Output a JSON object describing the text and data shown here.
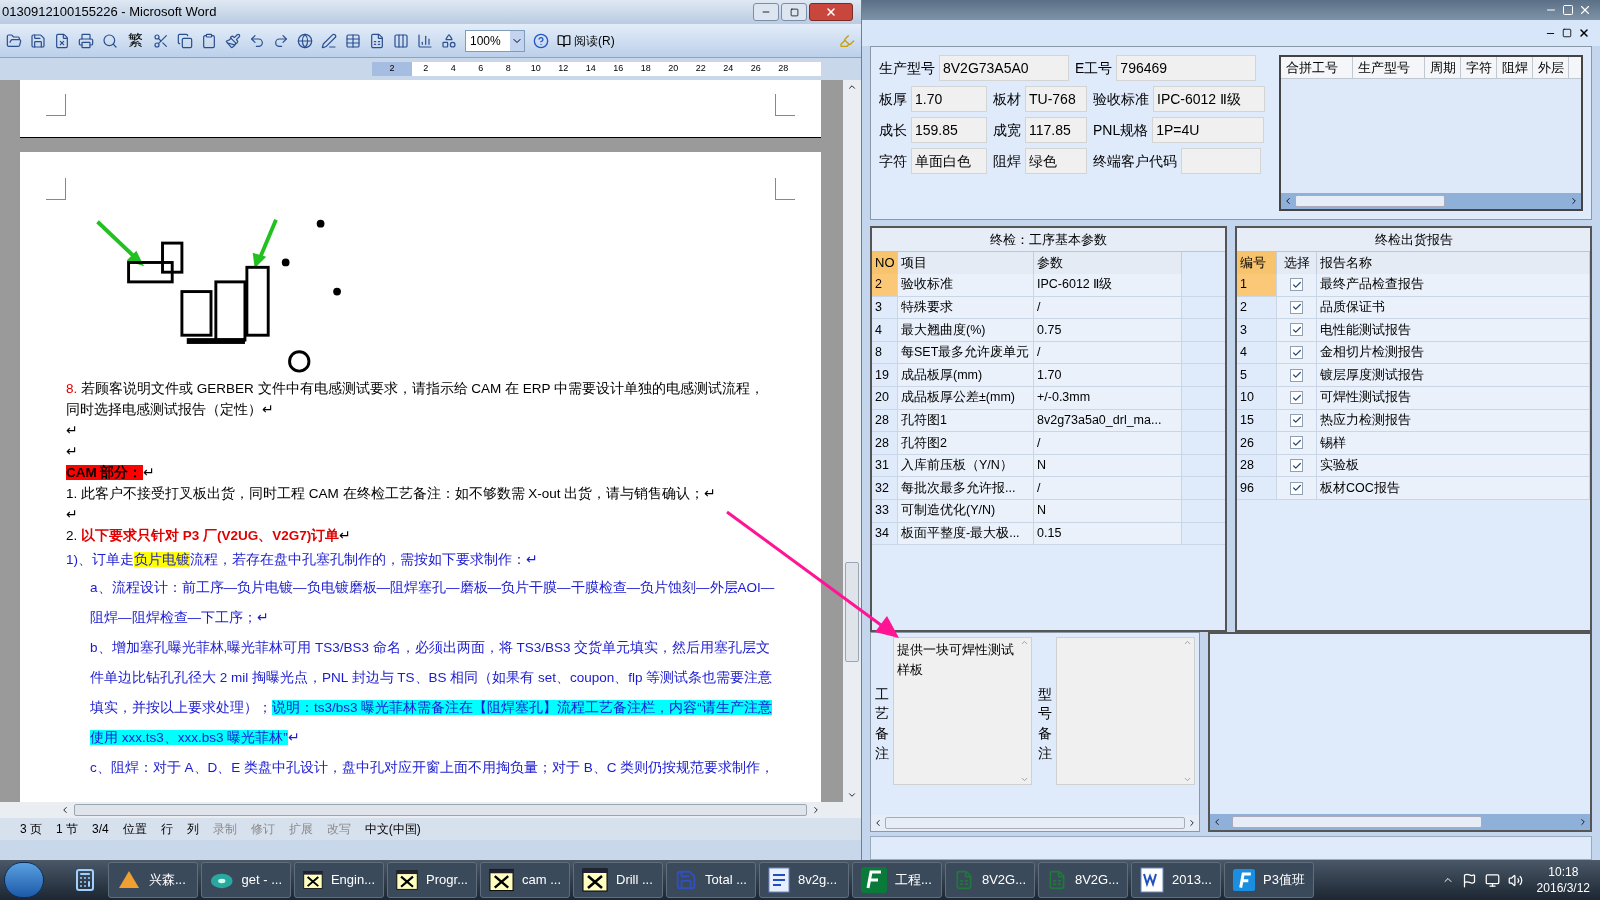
{
  "word": {
    "title": "0130912100155226 - Microsoft Word",
    "toolbar": {
      "traditional": "繁",
      "zoom": "100%",
      "read": "阅读(R)"
    },
    "ruler_ticks": [
      "2",
      "2",
      "4",
      "6",
      "8",
      "10",
      "12",
      "14",
      "16",
      "18",
      "20",
      "22",
      "24",
      "26",
      "28"
    ],
    "paragraphs": [
      {
        "kind": "plain",
        "segments": [
          {
            "kind": "number",
            "text": "8."
          },
          {
            "kind": "text",
            "text": " 若顾客说明文件或 GERBER 文件中有电感测试要求，请指示给 CAM 在 ERP 中需要设计单独的电感测试流程，同时选择电感测试报告（定性）↵"
          }
        ]
      },
      {
        "kind": "plain",
        "segments": [
          {
            "kind": "text",
            "text": "↵"
          }
        ]
      },
      {
        "kind": "plain",
        "segments": [
          {
            "kind": "text",
            "text": "↵"
          }
        ]
      },
      {
        "kind": "plain",
        "segments": [
          {
            "kind": "label",
            "text": "CAM 部分："
          },
          {
            "kind": "text",
            "text": "↵"
          }
        ]
      },
      {
        "kind": "plain",
        "segments": [
          {
            "kind": "text",
            "text": "1.   此客户不接受打叉板出货，同时工程 CAM 在终检工艺备注：如不够数需 X-out 出货，请与销售确认；↵"
          }
        ]
      },
      {
        "kind": "plain",
        "segments": [
          {
            "kind": "text",
            "text": "↵"
          }
        ]
      },
      {
        "kind": "plain",
        "segments": [
          {
            "kind": "text",
            "text": "2.   "
          },
          {
            "kind": "emphasis",
            "text": "以下要求只针对 P3 厂(V2UG、V2G7)订单"
          },
          {
            "kind": "text",
            "text": "↵"
          }
        ]
      },
      {
        "kind": "blue",
        "segments": [
          {
            "kind": "text",
            "text": "1)、订单走"
          },
          {
            "kind": "highlight",
            "text": "负片电镀"
          },
          {
            "kind": "text",
            "text": "流程，若存在盘中孔塞孔制作的，需按如下要求制作：↵"
          }
        ]
      },
      {
        "kind": "blue_indent",
        "segments": [
          {
            "kind": "text",
            "text": "a、流程设计：前工序—负片电镀—负电镀磨板—阻焊塞孔—磨板—负片干膜—干膜检查—负片蚀刻—外层AOI—阻焊—阻焊检查—下工序；↵"
          }
        ]
      },
      {
        "kind": "blue_indent",
        "segments": [
          {
            "kind": "text",
            "text": "b、增加塞孔曝光菲林,曝光菲林可用 TS3/BS3 命名，必须出两面，将 TS3/BS3 交货单元填实，然后用塞孔层文件单边比钻孔孔径大 2 mil 掏曝光点，PNL 封边与 TS、BS 相同（如果有 set、coupon、flp 等测试条也需要注意填实，并按以上要求处理）；"
          },
          {
            "kind": "note",
            "text": "说明：ts3/bs3 曝光菲林需备注在【阻焊塞孔】流程工艺备注栏，内容“请生产注意使用 xxx.ts3、xxx.bs3 曝光菲林”"
          },
          {
            "kind": "text",
            "text": "↵"
          }
        ]
      },
      {
        "kind": "blue_indent",
        "segments": [
          {
            "kind": "text",
            "text": "c、阻焊：对于 A、D、E 类盘中孔设计，盘中孔对应开窗上面不用掏负量；对于 B、C 类则仍按规范要求制作，"
          }
        ]
      }
    ],
    "status": [
      {
        "text": "3 页"
      },
      {
        "text": "1 节"
      },
      {
        "text": "3/4"
      },
      {
        "text": "位置"
      },
      {
        "text": "行"
      },
      {
        "text": "列"
      },
      {
        "text": "录制",
        "disabled": true
      },
      {
        "text": "修订",
        "disabled": true
      },
      {
        "text": "扩展",
        "disabled": true
      },
      {
        "text": "改写",
        "disabled": true
      },
      {
        "text": "中文(中国)"
      }
    ]
  },
  "app": {
    "fields": [
      [
        {
          "label": "生产型号",
          "value": "8V2G73A5A0"
        },
        {
          "label": "E工号",
          "value": "796469"
        }
      ],
      [
        {
          "label": "板厚",
          "value": "1.70"
        },
        {
          "label": "板材",
          "value": "TU-768"
        },
        {
          "label": "验收标准",
          "value": "IPC-6012 Ⅱ级"
        }
      ],
      [
        {
          "label": "成长",
          "value": "159.85"
        },
        {
          "label": "成宽",
          "value": "117.85"
        },
        {
          "label": "PNL规格",
          "value": "1P=4U"
        }
      ],
      [
        {
          "label": "字符",
          "value": "单面白色"
        },
        {
          "label": "阻焊",
          "value": "绿色"
        },
        {
          "label": "终端客户代码"
        }
      ]
    ],
    "merge_table": {
      "columns": [
        "合拼工号",
        "生产型号",
        "周期",
        "字符",
        "阻焊",
        "外层"
      ]
    },
    "params": {
      "title": "终检：工序基本参数",
      "columns": [
        "NO",
        "项目",
        "参数"
      ],
      "rows": [
        {
          "no": "2",
          "item": "验收标准",
          "value": "IPC-6012 Ⅱ级",
          "selected": true
        },
        {
          "no": "3",
          "item": "特殊要求",
          "value": "/",
          "selected": false
        },
        {
          "no": "4",
          "item": "最大翘曲度(%)",
          "value": "0.75",
          "selected": false
        },
        {
          "no": "8",
          "item": "每SET最多允许废单元",
          "value": "/",
          "selected": false
        },
        {
          "no": "19",
          "item": "成品板厚(mm)",
          "value": "1.70",
          "selected": false
        },
        {
          "no": "20",
          "item": "成品板厚公差±(mm)",
          "value": "+/-0.3mm",
          "selected": false
        },
        {
          "no": "28",
          "item": "孔符图1",
          "value": "8v2g73a5a0_drl_ma...",
          "selected": false
        },
        {
          "no": "28",
          "item": "孔符图2",
          "value": "/",
          "selected": false
        },
        {
          "no": "31",
          "item": "入库前压板（Y/N）",
          "value": "N",
          "selected": false
        },
        {
          "no": "32",
          "item": "每批次最多允许报...",
          "value": "/",
          "selected": false
        },
        {
          "no": "33",
          "item": "可制造优化(Y/N)",
          "value": "N",
          "selected": false
        },
        {
          "no": "34",
          "item": "板面平整度-最大极...",
          "value": "0.15",
          "selected": false
        }
      ]
    },
    "reports": {
      "title": "终检出货报告",
      "columns": [
        "编号",
        "选择",
        "报告名称"
      ],
      "rows": [
        {
          "no": "1",
          "checked": true,
          "name": "最终产品检查报告",
          "selected": true
        },
        {
          "no": "2",
          "checked": true,
          "name": "品质保证书",
          "selected": false
        },
        {
          "no": "3",
          "checked": true,
          "name": "电性能测试报告",
          "selected": false
        },
        {
          "no": "4",
          "checked": true,
          "name": "金相切片检测报告",
          "selected": false
        },
        {
          "no": "5",
          "checked": true,
          "name": "镀层厚度测试报告",
          "selected": false
        },
        {
          "no": "10",
          "checked": true,
          "name": "可焊性测试报告",
          "selected": false
        },
        {
          "no": "15",
          "checked": true,
          "name": "热应力检测报告",
          "selected": false
        },
        {
          "no": "26",
          "checked": true,
          "name": "锡样",
          "selected": false
        },
        {
          "no": "28",
          "checked": true,
          "name": "实验板",
          "selected": false
        },
        {
          "no": "96",
          "checked": true,
          "name": "板材COC报告",
          "selected": false
        }
      ]
    },
    "remarks": [
      {
        "label": "工艺备注",
        "text": "提供一块可焊性测试样板"
      },
      {
        "label": "型号备注"
      }
    ]
  },
  "taskbar": {
    "items": [
      {
        "kind": "calculator"
      },
      {
        "kind": "shell",
        "label": "兴森..."
      },
      {
        "kind": "disc",
        "label": "get - ..."
      },
      {
        "kind": "x",
        "label": "Engin..."
      },
      {
        "kind": "x",
        "label": "Progr..."
      },
      {
        "kind": "x",
        "label": "cam ..."
      },
      {
        "kind": "x",
        "label": "Drill ..."
      },
      {
        "kind": "floppy",
        "label": "Total ..."
      },
      {
        "kind": "doc",
        "label": "8v2g..."
      },
      {
        "kind": "fp",
        "label": "工程..."
      },
      {
        "kind": "excel",
        "label": "8V2G..."
      },
      {
        "kind": "excel",
        "label": "8V2G..."
      },
      {
        "kind": "word",
        "label": "2013..."
      },
      {
        "kind": "f",
        "label": "P3值班"
      }
    ],
    "time": "10:18",
    "date": "2016/3/12"
  }
}
